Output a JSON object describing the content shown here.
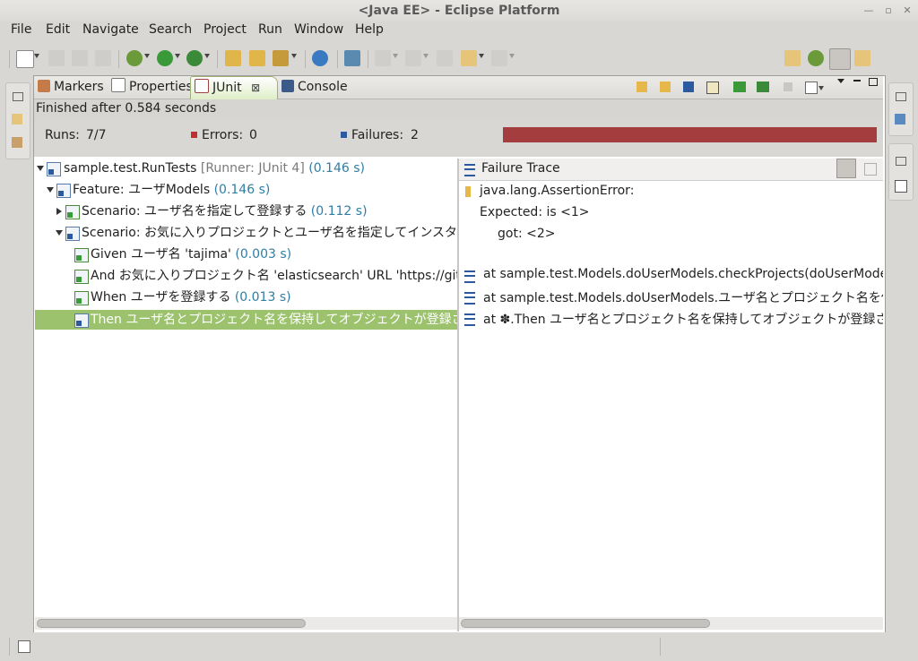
{
  "window": {
    "title": "<Java EE> - Eclipse Platform"
  },
  "menu": [
    "File",
    "Edit",
    "Navigate",
    "Search",
    "Project",
    "Run",
    "Window",
    "Help"
  ],
  "tabs": [
    {
      "label": "Markers",
      "active": false
    },
    {
      "label": "Properties",
      "active": false
    },
    {
      "label": "JUnit",
      "active": true,
      "close": "⊠"
    },
    {
      "label": "Console",
      "active": false
    }
  ],
  "status": "Finished after 0.584 seconds",
  "counters": {
    "runs_label": "Runs:",
    "runs_value": "7/7",
    "errors_label": "Errors:",
    "errors_value": "0",
    "failures_label": "Failures:",
    "failures_value": "2"
  },
  "progress": {
    "fraction": 1.0,
    "color": "#a43d3e"
  },
  "tree": [
    {
      "label": "sample.test.RunTests",
      "runner": "[Runner: JUnit 4]",
      "time": "(0.146 s)"
    },
    {
      "label": "Feature: ユーザModels",
      "time": "(0.146 s)"
    },
    {
      "label": "Scenario: ユーザ名を指定して登録する",
      "time": "(0.112 s)"
    },
    {
      "label": "Scenario: お気に入りプロジェクトとユーザ名を指定してインスタンスを生成",
      "time": ""
    },
    {
      "label": "Given ユーザ名 'tajima'",
      "time": "(0.003 s)"
    },
    {
      "label": "And お気に入りプロジェクト名 'elasticsearch' URL 'https://github.co",
      "time": ""
    },
    {
      "label": "When ユーザを登録する",
      "time": "(0.013 s)"
    },
    {
      "label": "Then ユーザ名とプロジェクト名を保持してオブジェクトが登録されること (",
      "time": ""
    }
  ],
  "trace": {
    "title": "Failure Trace",
    "lines": [
      "java.lang.AssertionError:",
      "Expected: is <1>",
      "got: <2>",
      "at sample.test.Models.doUserModels.checkProjects(doUserModels.ja",
      "at sample.test.Models.doUserModels.ユーザ名とプロジェクト名を保持して",
      "at ✽.Then ユーザ名とプロジェクト名を保持してオブジェクトが登録されること(sa"
    ]
  }
}
